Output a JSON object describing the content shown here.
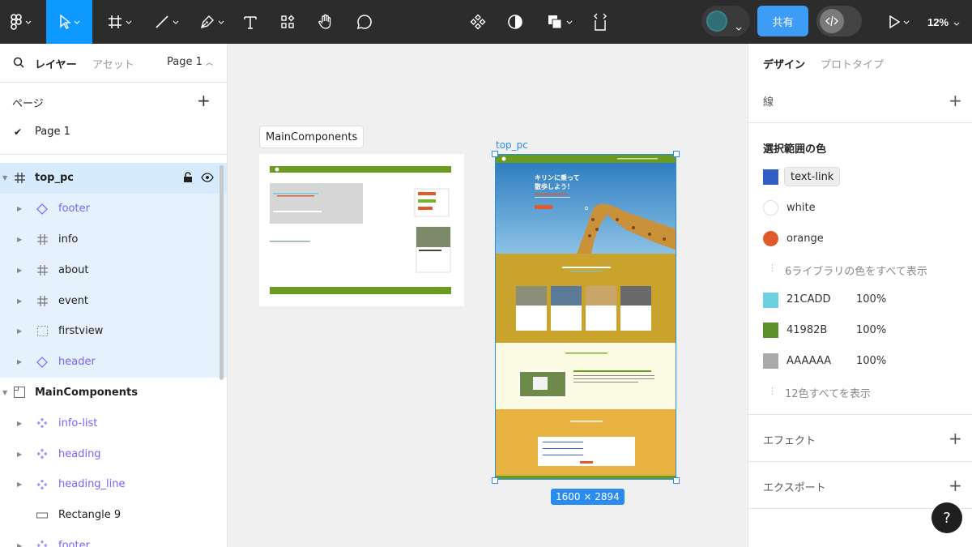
{
  "toolbar": {
    "share_label": "共有",
    "zoom": "12%",
    "icons": [
      "figma-menu-icon",
      "move-tool-icon",
      "frame-tool-icon",
      "line-tool-icon",
      "pen-tool-icon",
      "text-tool-icon",
      "resources-icon",
      "hand-tool-icon",
      "comment-icon",
      "component-icon",
      "mask-icon",
      "boolean-icon",
      "crop-icon",
      "play-icon"
    ]
  },
  "left_panel": {
    "tab_layers": "レイヤー",
    "tab_assets": "アセット",
    "page_selector": "Page 1",
    "pages_header": "ページ",
    "pages": [
      "Page 1"
    ],
    "layers": [
      {
        "label": "top_pc",
        "type": "frame",
        "depth": 0,
        "expanded": true
      },
      {
        "label": "footer",
        "type": "instance",
        "depth": 1
      },
      {
        "label": "info",
        "type": "frame",
        "depth": 1
      },
      {
        "label": "about",
        "type": "frame",
        "depth": 1
      },
      {
        "label": "event",
        "type": "frame",
        "depth": 1
      },
      {
        "label": "firstview",
        "type": "section",
        "depth": 1
      },
      {
        "label": "header",
        "type": "instance",
        "depth": 1
      },
      {
        "label": "MainComponents",
        "type": "section-frame",
        "depth": 0,
        "expanded": true
      },
      {
        "label": "info-list",
        "type": "component",
        "depth": 1
      },
      {
        "label": "heading",
        "type": "component",
        "depth": 1
      },
      {
        "label": "heading_line",
        "type": "component",
        "depth": 1
      },
      {
        "label": "Rectangle 9",
        "type": "rectangle",
        "depth": 1
      },
      {
        "label": "footer",
        "type": "component",
        "depth": 1
      }
    ]
  },
  "canvas": {
    "main_components_label": "MainComponents",
    "top_pc_label": "top_pc",
    "size_badge": "1600 × 2894",
    "mockup": {
      "hero_title_1": "キリンに乗って",
      "hero_title_2": "散歩しよう！"
    }
  },
  "right_panel": {
    "tab_design": "デザイン",
    "tab_prototype": "プロトタイプ",
    "stroke": "線",
    "selection_colors": "選択範囲の色",
    "styles": [
      {
        "name": "text-link",
        "color": "#2f5fc4",
        "shape": "square",
        "chip": true
      },
      {
        "name": "white",
        "color": "#ffffff",
        "shape": "round"
      },
      {
        "name": "orange",
        "color": "#e05a2b",
        "shape": "round"
      }
    ],
    "show_library": "6ライブラリの色をすべて表示",
    "colors": [
      {
        "hex": "21CADD",
        "color": "#6cd0e0",
        "opacity": "100%"
      },
      {
        "hex": "41982B",
        "color": "#5a8f2a",
        "opacity": "100%"
      },
      {
        "hex": "AAAAAA",
        "color": "#aaaaaa",
        "opacity": "100%"
      }
    ],
    "show_all": "12色すべてを表示",
    "effects": "エフェクト",
    "export": "エクスポート",
    "help": "?"
  }
}
